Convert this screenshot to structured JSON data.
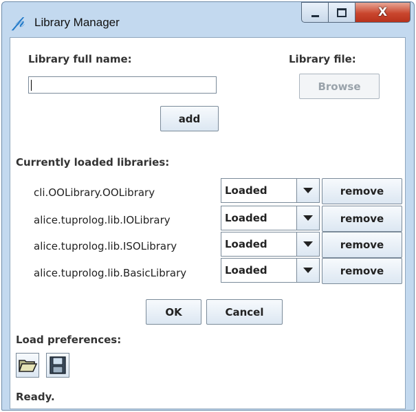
{
  "window": {
    "title": "Library Manager",
    "close_glyph": "X"
  },
  "icons": {
    "app": "tuprolog-icon",
    "minimize": "minimize-icon",
    "maximize": "maximize-icon",
    "close": "close-icon",
    "open": "open-folder-icon",
    "save": "floppy-disk-icon"
  },
  "form": {
    "library_full_name_label": "Library full name:",
    "library_full_name_value": "",
    "library_file_label": "Library file:",
    "browse_label": "Browse",
    "add_label": "add"
  },
  "libraries": {
    "section_label": "Currently loaded libraries:",
    "remove_label": "remove",
    "items": [
      {
        "name": "cli.OOLibrary.OOLibrary",
        "status": "Loaded"
      },
      {
        "name": "alice.tuprolog.lib.IOLibrary",
        "status": "Loaded"
      },
      {
        "name": "alice.tuprolog.lib.ISOLibrary",
        "status": "Loaded"
      },
      {
        "name": "alice.tuprolog.lib.BasicLibrary",
        "status": "Loaded"
      }
    ]
  },
  "actions": {
    "ok_label": "OK",
    "cancel_label": "Cancel"
  },
  "preferences": {
    "label": "Load preferences:"
  },
  "status": {
    "text": "Ready."
  }
}
